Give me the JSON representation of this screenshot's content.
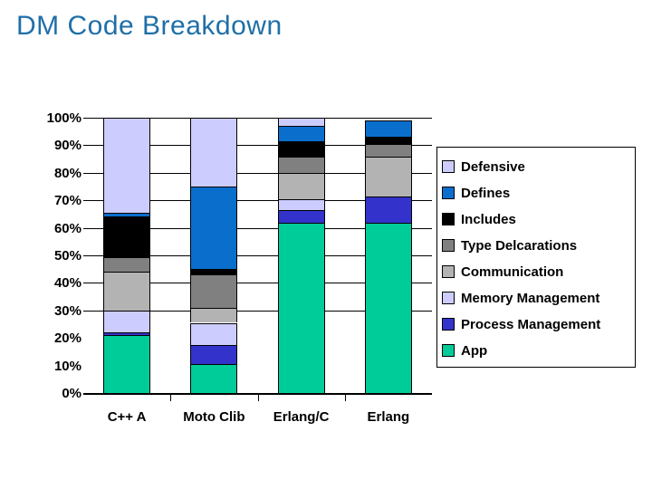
{
  "chart_data": {
    "type": "bar",
    "subtype": "stacked-100-percent",
    "title": "DM Code Breakdown",
    "xlabel": "",
    "ylabel": "",
    "ylim": [
      0,
      100
    ],
    "ytick_labels": [
      "100%",
      "90%",
      "80%",
      "70%",
      "60%",
      "50%",
      "40%",
      "30%",
      "20%",
      "10%",
      "0%"
    ],
    "ytick_values": [
      100,
      90,
      80,
      70,
      60,
      50,
      40,
      30,
      20,
      10,
      0
    ],
    "grid": true,
    "legend_position": "right",
    "categories": [
      "C++ A",
      "Moto Clib",
      "Erlang/C",
      "Erlang"
    ],
    "series": [
      {
        "name": "App",
        "color": "#00CC99",
        "values": [
          21,
          10.5,
          62,
          62
        ]
      },
      {
        "name": "Process Management",
        "color": "#3333CC",
        "values": [
          1,
          7,
          4.5,
          9.5
        ]
      },
      {
        "name": "Memory Management",
        "color": "#CCCCFF",
        "values": [
          8,
          8,
          4,
          0
        ]
      },
      {
        "name": "Communication",
        "color": "#B3B3B3",
        "values": [
          14,
          5.5,
          9.5,
          14.5
        ]
      },
      {
        "name": "Type Delcarations",
        "color": "#808080",
        "values": [
          5.5,
          12,
          6,
          4.5
        ]
      },
      {
        "name": "Includes",
        "color": "#000000",
        "values": [
          14.5,
          2,
          5.5,
          2.5
        ]
      },
      {
        "name": "Defines",
        "color": "#0A6FCC",
        "values": [
          1.5,
          30,
          5.5,
          6
        ]
      },
      {
        "name": "Defensive",
        "color": "#CCCCFF",
        "values": [
          34.5,
          25,
          3,
          0
        ]
      }
    ],
    "legend_entries": [
      {
        "label": "Defensive",
        "color": "#CCCCFF"
      },
      {
        "label": "Defines",
        "color": "#0A6FCC"
      },
      {
        "label": "Includes",
        "color": "#000000"
      },
      {
        "label": "Type Delcarations",
        "color": "#808080"
      },
      {
        "label": "Communication",
        "color": "#B3B3B3"
      },
      {
        "label": "Memory Management",
        "color": "#CCCCFF"
      },
      {
        "label": "Process Management",
        "color": "#3333CC"
      },
      {
        "label": "App",
        "color": "#00CC99"
      }
    ]
  },
  "theme": {
    "title_color": "#1F6FA8",
    "axis_color": "#000000",
    "background": "#FFFFFF"
  }
}
